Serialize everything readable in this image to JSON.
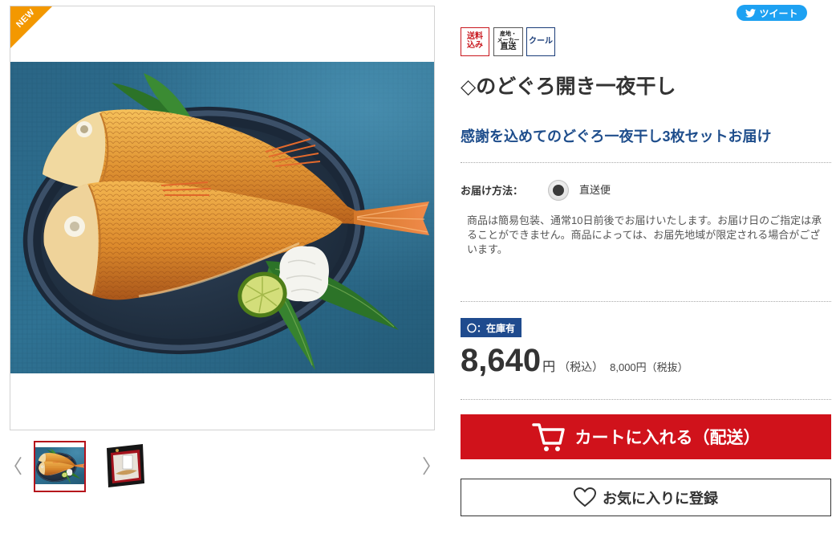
{
  "product_gallery": {
    "ribbon_label": "NEW",
    "ribbon_color": "#f39800",
    "prev_arrow": "〈",
    "next_arrow": "〉",
    "selected_border_color": "#b5121b",
    "thumbnails": [
      {
        "icon": "grilled-fish-thumbnail",
        "selected": true
      },
      {
        "icon": "gift-box-thumbnail",
        "selected": false
      }
    ]
  },
  "share": {
    "tweet_label": "ツイート",
    "icon": "twitter-bird-icon",
    "color": "#1da1f2"
  },
  "badges": [
    {
      "lines": [
        "送料",
        "込み"
      ],
      "color": "#c8161d"
    },
    {
      "lines": [
        "産地・",
        "メーカー",
        "直送"
      ],
      "color": "#222222"
    },
    {
      "lines": [
        "クール"
      ],
      "color": "#1a3c78"
    }
  ],
  "product": {
    "title": "◇のどぐろ開き一夜干し",
    "catchcopy": "感謝を込めてのどぐろ一夜干し3枚セットお届け"
  },
  "delivery": {
    "label": "お届け方法：",
    "option_label": "直送便",
    "option_selected": true,
    "note": "商品は簡易包装、通常10日前後でお届けいたします。お届け日のご指定は承ることができません。商品によっては、お届先地域が限定される場合がございます。"
  },
  "stock": {
    "label": "〇：在庫有",
    "color": "#1f4b8e"
  },
  "price": {
    "tax_included": "8,640",
    "currency": "円",
    "tax_included_label": "（税込）",
    "tax_excluded": "8,000円",
    "tax_excluded_label": "（税抜）"
  },
  "actions": {
    "add_to_cart_label": "カートに入れる（配送）",
    "add_to_cart_icon": "cart-icon",
    "add_to_cart_color": "#d0121b",
    "favorite_label": "お気に入りに登録",
    "favorite_icon": "heart-icon"
  }
}
